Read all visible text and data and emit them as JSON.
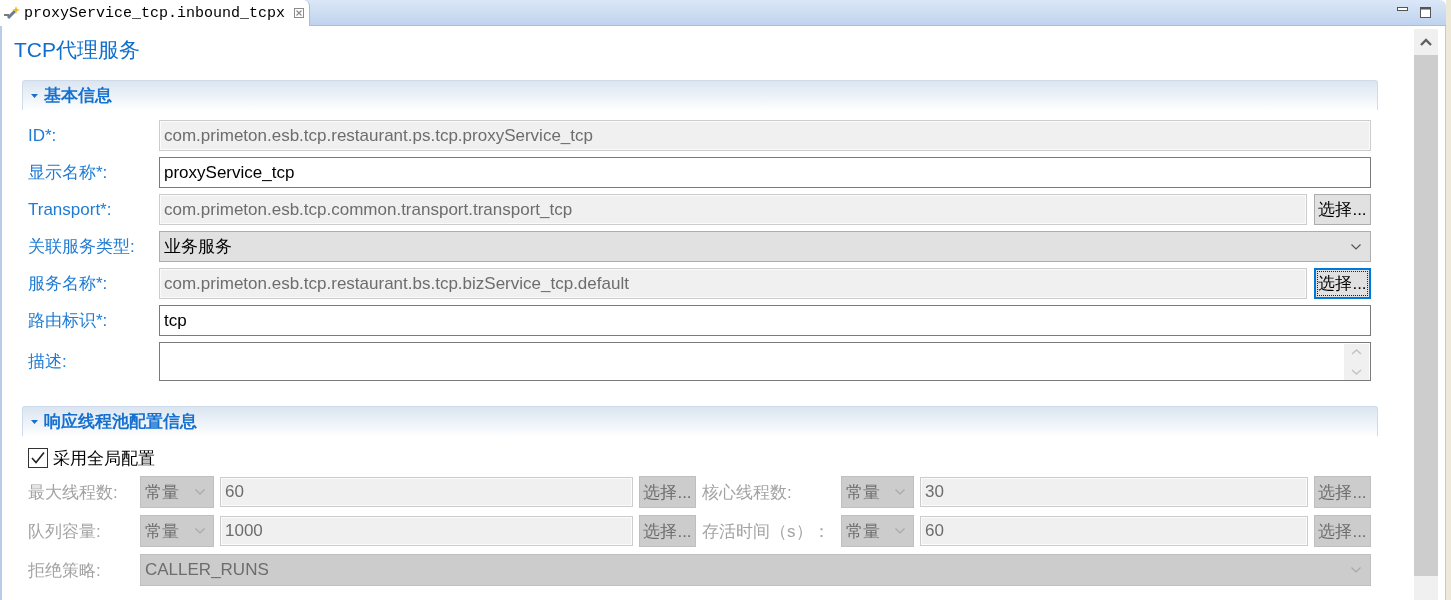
{
  "tabs": [
    {
      "label": "proxyService_tcp.inbound_tcpx",
      "selected": true
    }
  ],
  "title": "TCP代理服务",
  "sections": [
    {
      "kind": "form",
      "title": "基本信息",
      "expanded": true,
      "fields": [
        {
          "kind": "text",
          "label": "ID*:",
          "value": "com.primeton.esb.tcp.restaurant.ps.tcp.proxyService_tcp",
          "disabled": true
        },
        {
          "kind": "text",
          "label": "显示名称*:",
          "value": "proxyService_tcp",
          "disabled": false
        },
        {
          "kind": "text",
          "label": "Transport*:",
          "value": "com.primeton.esb.tcp.common.transport.transport_tcp",
          "disabled": true,
          "button": {
            "label": "选择...",
            "focused": false
          }
        },
        {
          "kind": "select",
          "label": "关联服务类型:",
          "value": "业务服务",
          "disabled": false
        },
        {
          "kind": "text",
          "label": "服务名称*:",
          "value": "com.primeton.esb.tcp.restaurant.bs.tcp.bizService_tcp.default",
          "disabled": true,
          "button": {
            "label": "选择...",
            "focused": true
          }
        },
        {
          "kind": "text",
          "label": "路由标识*:",
          "value": "tcp",
          "disabled": false
        },
        {
          "kind": "textarea",
          "label": "描述:",
          "disabled": false
        }
      ]
    },
    {
      "kind": "grid",
      "title": "响应线程池配置信息",
      "expanded": true,
      "checkbox": {
        "label": "采用全局配置",
        "checked": true
      },
      "fields": [
        {
          "kind": "expression",
          "label": "最大线程数:",
          "mode": "常量",
          "value": "60",
          "button": "选择...",
          "disabled": true
        },
        {
          "kind": "expression",
          "label": "核心线程数:",
          "mode": "常量",
          "value": "30",
          "button": "选择...",
          "disabled": true
        },
        {
          "kind": "expression",
          "label": "队列容量:",
          "mode": "常量",
          "value": "1000",
          "button": "选择...",
          "disabled": true
        },
        {
          "kind": "expression",
          "label": "存活时间（s）：",
          "mode": "常量",
          "value": "60",
          "button": "选择...",
          "disabled": true
        },
        {
          "kind": "select",
          "label": "拒绝策略:",
          "value": "CALLER_RUNS",
          "disabled": true
        }
      ]
    }
  ]
}
